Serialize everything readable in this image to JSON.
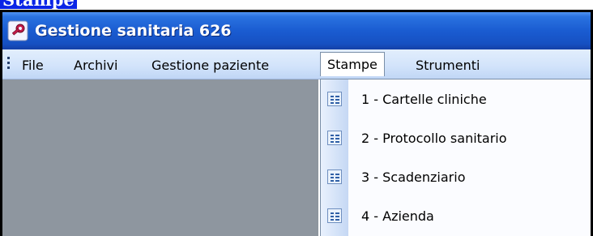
{
  "heading": "Stampe",
  "window": {
    "title": "Gestione sanitaria 626",
    "icon": "key-icon"
  },
  "menubar": {
    "items": [
      "File",
      "Archivi",
      "Gestione paziente",
      "Stampe",
      "Strumenti"
    ],
    "active": "Stampe"
  },
  "dropdown": {
    "items": [
      {
        "label": "1 - Cartelle cliniche",
        "icon": "report-icon"
      },
      {
        "label": "2 - Protocollo sanitario",
        "icon": "report-icon"
      },
      {
        "label": "3 - Scadenziario",
        "icon": "report-icon"
      },
      {
        "label": "4 - Azienda",
        "icon": "report-icon"
      }
    ]
  },
  "colors": {
    "titlebar": "#1a5cd1",
    "heading_bg": "#0a24e6",
    "workspace": "#8e969f"
  }
}
